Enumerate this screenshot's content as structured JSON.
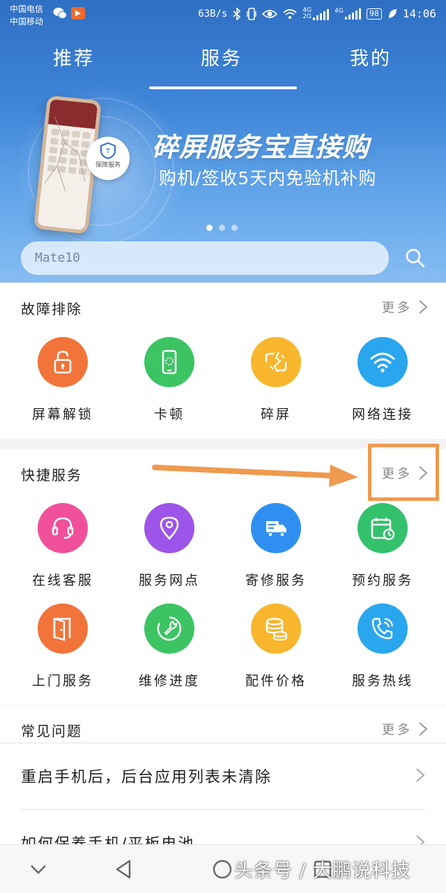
{
  "status_bar": {
    "carrier_1": "中国电信",
    "carrier_2": "中国移动",
    "net_speed": "63B/s",
    "net_type_1": "4G",
    "net_type_1b": "2G",
    "net_type_2": "4G",
    "battery": "98",
    "time": "14:06"
  },
  "tabs": [
    {
      "label": "推荐"
    },
    {
      "label": "服务",
      "active": true
    },
    {
      "label": "我的"
    }
  ],
  "banner": {
    "title": "碎屏服务宝直接购",
    "subtitle": "购机/签收5天内免验机补购",
    "badge_label": "保障服务",
    "slide_count": 3,
    "active_slide": 1
  },
  "search": {
    "placeholder": "Mate10"
  },
  "fault_section": {
    "title": "故障排除",
    "more": "更多",
    "items": [
      {
        "label": "屏幕解锁",
        "icon": "lock-icon",
        "color": "#f2743a"
      },
      {
        "label": "卡顿",
        "icon": "phone-lag-icon",
        "color": "#3cc463"
      },
      {
        "label": "碎屏",
        "icon": "broken-screen-icon",
        "color": "#f7b62c"
      },
      {
        "label": "网络连接",
        "icon": "wifi-icon",
        "color": "#2aa6ee"
      }
    ]
  },
  "quick_section": {
    "title": "快捷服务",
    "more": "更多",
    "items": [
      {
        "label": "在线客服",
        "icon": "headset-icon",
        "color": "#f0509a"
      },
      {
        "label": "服务网点",
        "icon": "location-icon",
        "color": "#9c55e8"
      },
      {
        "label": "寄修服务",
        "icon": "truck-icon",
        "color": "#2f8ff0"
      },
      {
        "label": "预约服务",
        "icon": "calendar-icon",
        "color": "#33c16c"
      },
      {
        "label": "上门服务",
        "icon": "door-icon",
        "color": "#f2743a"
      },
      {
        "label": "维修进度",
        "icon": "wrench-icon",
        "color": "#3cc463"
      },
      {
        "label": "配件价格",
        "icon": "coins-icon",
        "color": "#f7b62c"
      },
      {
        "label": "服务热线",
        "icon": "phone-call-icon",
        "color": "#2aa6ee"
      }
    ]
  },
  "faq_section": {
    "title": "常见问题",
    "more": "更多",
    "items": [
      {
        "text": "重启手机后，后台应用列表未清除"
      },
      {
        "text": "如何保养手机/平板电池"
      }
    ]
  },
  "watermark": "头条号 / 大鹏说科技",
  "colors": {
    "accent_orange": "#ee9a4f",
    "hero_blue": "#3f86d8"
  }
}
